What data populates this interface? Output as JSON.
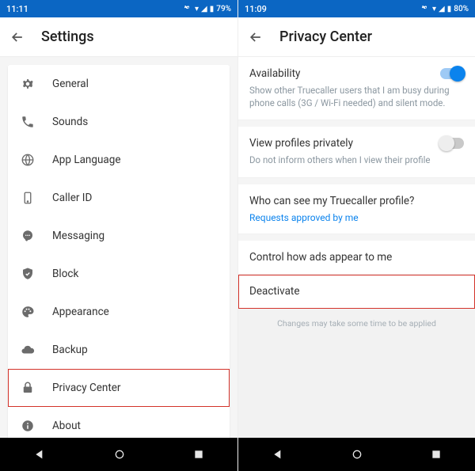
{
  "left": {
    "status": {
      "time": "11:11",
      "battery": "79%",
      "indicators": "▲ ▮"
    },
    "header": {
      "title": "Settings"
    },
    "items": [
      {
        "label": "General"
      },
      {
        "label": "Sounds"
      },
      {
        "label": "App Language"
      },
      {
        "label": "Caller ID"
      },
      {
        "label": "Messaging"
      },
      {
        "label": "Block"
      },
      {
        "label": "Appearance"
      },
      {
        "label": "Backup"
      },
      {
        "label": "Privacy Center"
      },
      {
        "label": "About"
      }
    ]
  },
  "right": {
    "status": {
      "time": "11:09",
      "battery": "80%",
      "indicators": "▲ ▮"
    },
    "header": {
      "title": "Privacy Center"
    },
    "availability": {
      "title": "Availability",
      "sub": "Show other Truecaller users that I am busy during phone calls (3G / Wi-Fi needed) and silent mode."
    },
    "viewprivately": {
      "title": "View profiles privately",
      "sub": "Do not inform others when I view their profile"
    },
    "whocansee": {
      "title": "Who can see my Truecaller profile?",
      "link": "Requests approved by me"
    },
    "ads": {
      "title": "Control how ads appear to me"
    },
    "deactivate": {
      "title": "Deactivate"
    },
    "footnote": "Changes may take some time to be applied"
  }
}
